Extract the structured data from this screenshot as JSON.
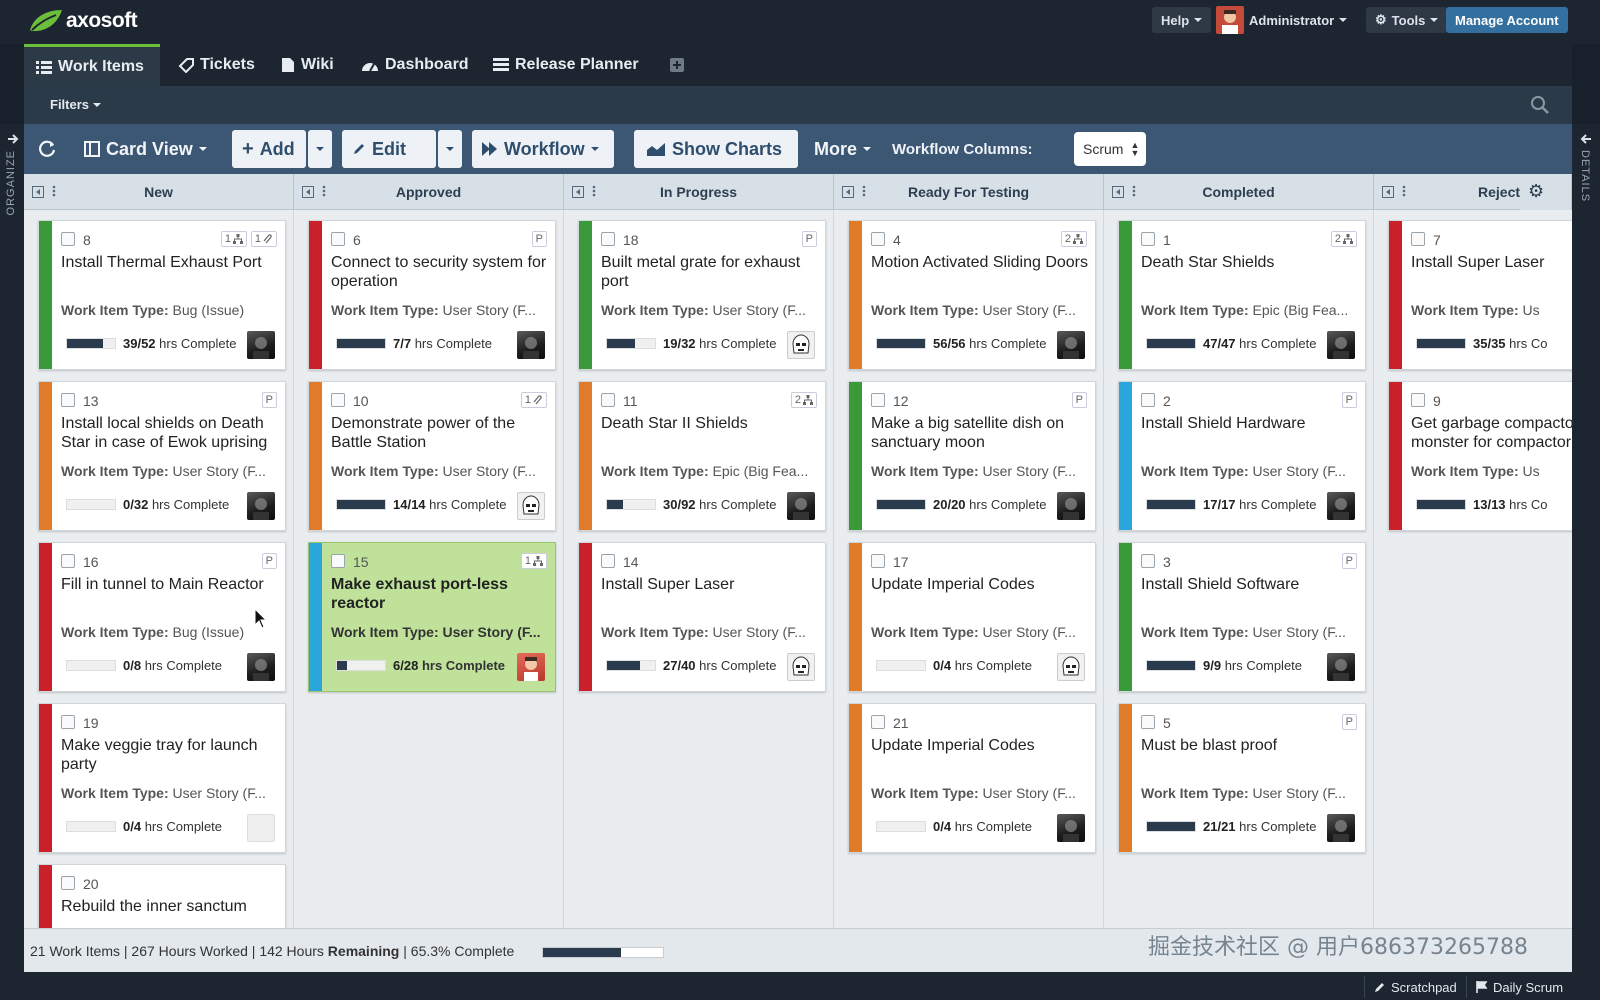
{
  "app": {
    "logo_text": "axosoft"
  },
  "topnav": {
    "help": "Help",
    "user": "Administrator",
    "tools": "Tools",
    "manage": "Manage Account"
  },
  "tabs": [
    "Work Items",
    "Tickets",
    "Wiki",
    "Dashboard",
    "Release Planner"
  ],
  "filterbar": {
    "filters": "Filters"
  },
  "sides": {
    "left": "ORGANIZE",
    "right": "DETAILS"
  },
  "toolbar": {
    "card_view": "Card View",
    "add": "Add",
    "edit": "Edit",
    "workflow": "Workflow",
    "show_charts": "Show Charts",
    "more": "More",
    "workflow_columns_label": "Workflow Columns:",
    "workflow_columns_value": "Scrum"
  },
  "columns": [
    "New",
    "Approved",
    "In Progress",
    "Ready For Testing",
    "Completed",
    "Rejected"
  ],
  "cards": [
    [
      {
        "num": "8",
        "title": "Install Thermal Exhaust Port",
        "type": "Bug (Issue)",
        "hrs": "39/52",
        "progress": 0.75,
        "color": "#3a9a3a",
        "badges": [
          "1 hier",
          "1 clip"
        ],
        "avatar": "dark"
      },
      {
        "num": "13",
        "title": "Install local shields on Death Star in case of Ewok uprising",
        "type": "User Story (F...",
        "hrs": "0/32",
        "progress": 0,
        "color": "#e07b2a",
        "badges": [
          "P"
        ],
        "avatar": "dark"
      },
      {
        "num": "16",
        "title": "Fill in tunnel to Main Reactor",
        "type": "Bug (Issue)",
        "hrs": "0/8",
        "progress": 0,
        "color": "#c9202a",
        "badges": [
          "P"
        ],
        "avatar": "dark"
      },
      {
        "num": "19",
        "title": "Make veggie tray for launch party",
        "type": "User Story (F...",
        "hrs": "0/4",
        "progress": 0,
        "color": "#c9202a",
        "badges": [],
        "avatar": "empty"
      },
      {
        "num": "20",
        "title": "Rebuild the inner sanctum",
        "type": "",
        "hrs": "",
        "progress": 0,
        "color": "#c9202a",
        "badges": [],
        "avatar": "none"
      }
    ],
    [
      {
        "num": "6",
        "title": "Connect to security system for operation",
        "type": "User Story (F...",
        "hrs": "7/7",
        "progress": 1,
        "color": "#c9202a",
        "badges": [
          "P"
        ],
        "avatar": "dark"
      },
      {
        "num": "10",
        "title": "Demonstrate power of the Battle Station",
        "type": "User Story (F...",
        "hrs": "14/14",
        "progress": 1,
        "color": "#e07b2a",
        "badges": [
          "1 clip"
        ],
        "avatar": "trooper"
      },
      {
        "num": "15",
        "title": "Make exhaust port-less reactor",
        "type": "User Story (F...",
        "hrs": "6/28",
        "progress": 0.21,
        "color": "#2aa6dc",
        "badges": [
          "1 hier"
        ],
        "avatar": "red",
        "selected": true
      }
    ],
    [
      {
        "num": "18",
        "title": "Built metal grate for exhaust port",
        "type": "User Story (F...",
        "hrs": "19/32",
        "progress": 0.59,
        "color": "#3a9a3a",
        "badges": [
          "P"
        ],
        "avatar": "trooper"
      },
      {
        "num": "11",
        "title": "Death Star II Shields",
        "type": "Epic (Big Fea...",
        "hrs": "30/92",
        "progress": 0.33,
        "color": "#e07b2a",
        "badges": [
          "2 hier"
        ],
        "avatar": "dark"
      },
      {
        "num": "14",
        "title": "Install Super Laser",
        "type": "User Story (F...",
        "hrs": "27/40",
        "progress": 0.68,
        "color": "#c9202a",
        "badges": [],
        "avatar": "trooper"
      }
    ],
    [
      {
        "num": "4",
        "title": "Motion Activated Sliding Doors",
        "type": "User Story (F...",
        "hrs": "56/56",
        "progress": 1,
        "color": "#e07b2a",
        "badges": [
          "2 hier"
        ],
        "avatar": "dark"
      },
      {
        "num": "12",
        "title": "Make a big satellite dish on sanctuary moon",
        "type": "User Story (F...",
        "hrs": "20/20",
        "progress": 1,
        "color": "#3a9a3a",
        "badges": [
          "P"
        ],
        "avatar": "dark"
      },
      {
        "num": "17",
        "title": "Update Imperial Codes",
        "type": "User Story (F...",
        "hrs": "0/4",
        "progress": 0,
        "color": "#e07b2a",
        "badges": [],
        "avatar": "trooper"
      },
      {
        "num": "21",
        "title": "Update Imperial Codes",
        "type": "User Story (F...",
        "hrs": "0/4",
        "progress": 0,
        "color": "#e07b2a",
        "badges": [],
        "avatar": "dark"
      }
    ],
    [
      {
        "num": "1",
        "title": "Death Star Shields",
        "type": "Epic (Big Fea...",
        "hrs": "47/47",
        "progress": 1,
        "color": "#3a9a3a",
        "badges": [
          "2 hier"
        ],
        "avatar": "dark"
      },
      {
        "num": "2",
        "title": "Install Shield Hardware",
        "type": "User Story (F...",
        "hrs": "17/17",
        "progress": 1,
        "color": "#2aa6dc",
        "badges": [
          "P"
        ],
        "avatar": "dark"
      },
      {
        "num": "3",
        "title": "Install Shield Software",
        "type": "User Story (F...",
        "hrs": "9/9",
        "progress": 1,
        "color": "#3a9a3a",
        "badges": [
          "P"
        ],
        "avatar": "dark"
      },
      {
        "num": "5",
        "title": "Must be blast proof",
        "type": "User Story (F...",
        "hrs": "21/21",
        "progress": 1,
        "color": "#e07b2a",
        "badges": [
          "P"
        ],
        "avatar": "dark"
      }
    ],
    [
      {
        "num": "7",
        "title": "Install Super Laser",
        "type": "Us",
        "hrs": "35/35",
        "hrs_suffix": "hrs Co",
        "progress": 1,
        "color": "#c9202a",
        "badges": [],
        "avatar": "none"
      },
      {
        "num": "9",
        "title": "Get garbage compactor monster for compactor",
        "type": "Us",
        "hrs": "13/13",
        "hrs_suffix": "hrs Co",
        "progress": 1,
        "color": "#c9202a",
        "badges": [],
        "avatar": "none"
      }
    ]
  ],
  "labels": {
    "work_item_type": "Work Item Type:",
    "hrs_complete": "hrs Complete"
  },
  "status": {
    "work_items": "21 Work Items",
    "hours_worked": "267 Hours Worked",
    "remaining_num": "142 Hours",
    "remaining_word": "Remaining",
    "percent": "65.3% Complete",
    "progress": 0.653
  },
  "watermark": "掘金技术社区 @ 用户686373265788",
  "bottom": {
    "scratchpad": "Scratchpad",
    "daily_scrum": "Daily Scrum"
  }
}
